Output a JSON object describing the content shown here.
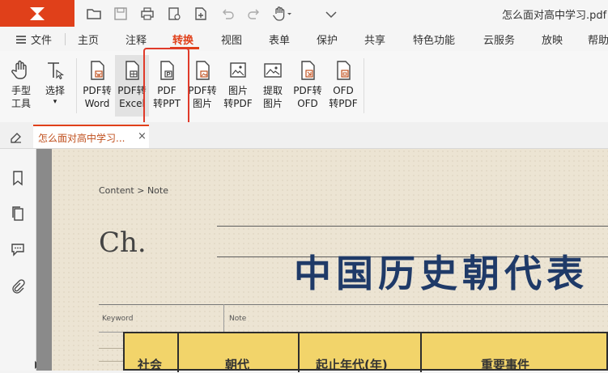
{
  "window": {
    "title": "怎么面对高中学习.pdf -"
  },
  "menu": {
    "items": [
      {
        "id": "file",
        "label": "文件"
      },
      {
        "id": "home",
        "label": "主页"
      },
      {
        "id": "annotate",
        "label": "注释"
      },
      {
        "id": "convert",
        "label": "转换"
      },
      {
        "id": "view",
        "label": "视图"
      },
      {
        "id": "form",
        "label": "表单"
      },
      {
        "id": "protect",
        "label": "保护"
      },
      {
        "id": "share",
        "label": "共享"
      },
      {
        "id": "features",
        "label": "特色功能"
      },
      {
        "id": "cloud",
        "label": "云服务"
      },
      {
        "id": "show",
        "label": "放映"
      },
      {
        "id": "help",
        "label": "帮助"
      }
    ],
    "active": "转换"
  },
  "ribbon": {
    "hand_tool": {
      "line1": "手型",
      "line2": "工具"
    },
    "select_tool": {
      "line1": "选择",
      "line2": "▾"
    },
    "pdf_to_word": {
      "line1": "PDF转",
      "line2": "Word"
    },
    "pdf_to_excel": {
      "line1": "PDF转",
      "line2": "Excel"
    },
    "pdf_to_ppt": {
      "line1": "PDF",
      "line2": "转PPT"
    },
    "pdf_to_image": {
      "line1": "PDF转",
      "line2": "图片"
    },
    "image_to_pdf": {
      "line1": "图片",
      "line2": "转PDF"
    },
    "extract_image": {
      "line1": "提取",
      "line2": "图片"
    },
    "pdf_to_ofd": {
      "line1": "PDF转",
      "line2": "OFD"
    },
    "ofd_to_pdf": {
      "line1": "OFD",
      "line2": "转PDF"
    }
  },
  "tab": {
    "label": "怎么面对高中学习...",
    "close": "×"
  },
  "document": {
    "breadcrumb": "Content > Note",
    "chapter": "Ch.",
    "title": "中国历史朝代表",
    "keyword_label": "Keyword",
    "note_label": "Note",
    "table_headers": [
      "社会",
      "朝代",
      "起止年代(年)",
      "重要事件"
    ]
  },
  "colors": {
    "brand": "#e0401a",
    "title_text": "#1f3a68",
    "table_header_bg": "#f2d46a",
    "highlight_box": "#e03a2a"
  }
}
